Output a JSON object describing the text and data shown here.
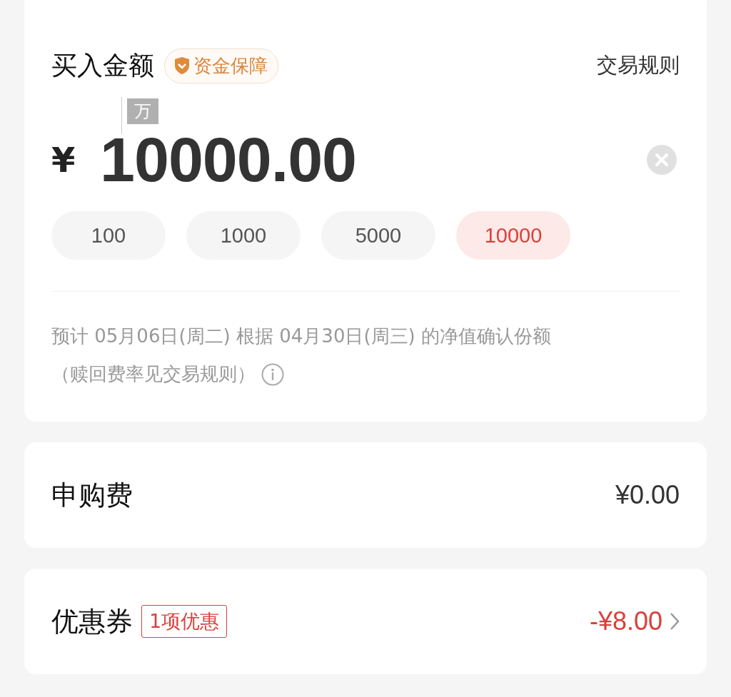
{
  "amount_card": {
    "title": "买入金额",
    "badge": "资金保障",
    "rules_link": "交易规则",
    "unit_hint": "万",
    "currency": "¥",
    "amount": "10000.00",
    "presets": [
      {
        "label": "100",
        "selected": false
      },
      {
        "label": "1000",
        "selected": false
      },
      {
        "label": "5000",
        "selected": false
      },
      {
        "label": "10000",
        "selected": true
      }
    ],
    "note": "预计 05月06日(周二) 根据 04月30日(周三) 的净值确认份额",
    "note_2": "（赎回费率见交易规则）"
  },
  "fee": {
    "label": "申购费",
    "value": "¥0.00"
  },
  "coupon": {
    "label": "优惠券",
    "tag": "1项优惠",
    "value": "-¥8.00"
  }
}
